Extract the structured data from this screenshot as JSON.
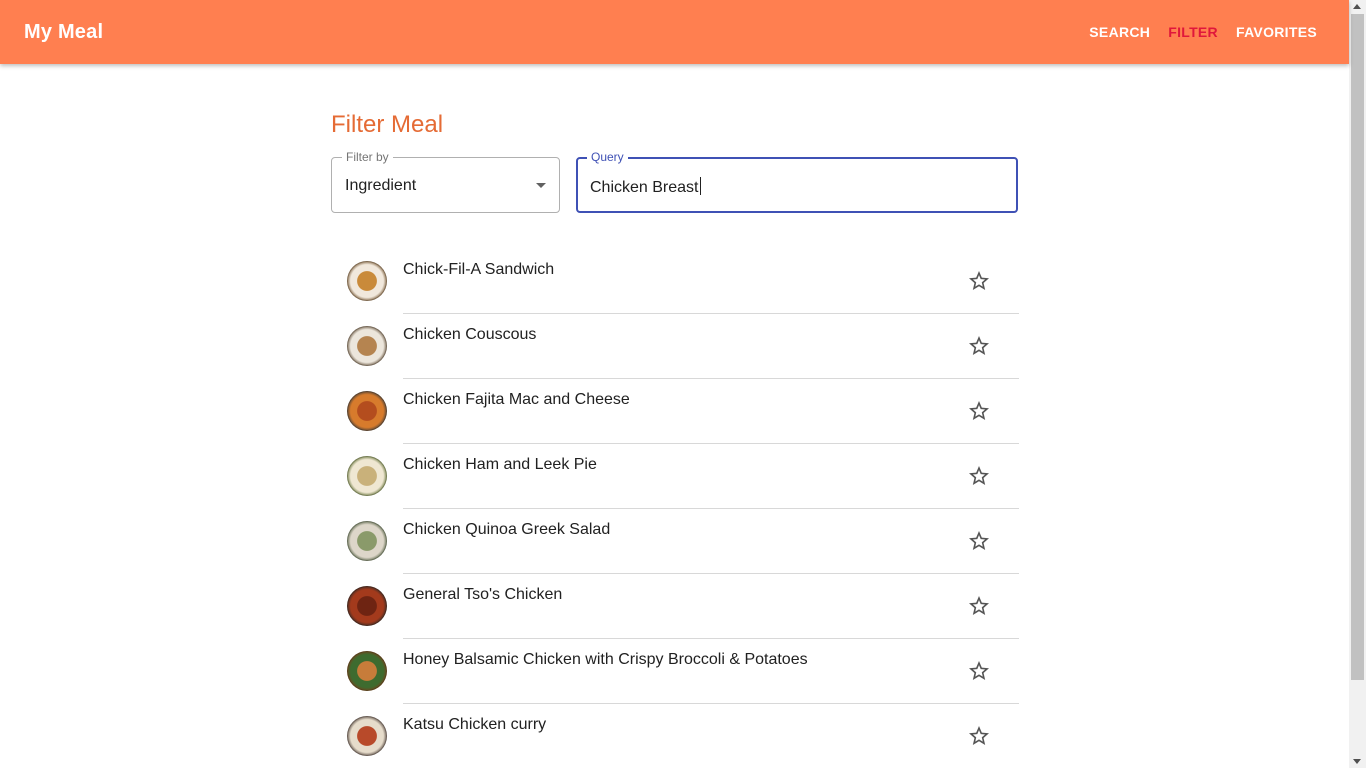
{
  "app": {
    "title": "My Meal"
  },
  "nav": [
    {
      "label": "SEARCH",
      "active": false
    },
    {
      "label": "FILTER",
      "active": true
    },
    {
      "label": "FAVORITES",
      "active": false
    }
  ],
  "page": {
    "title": "Filter Meal"
  },
  "filter": {
    "label": "Filter by",
    "value": "Ingredient"
  },
  "query": {
    "label": "Query",
    "value": "Chicken Breast"
  },
  "colors": {
    "appbar": "#ff7f50",
    "active_nav": "#e0173b",
    "title": "#e56b35",
    "focus": "#3f51b5"
  },
  "meals": [
    {
      "name": "Chick-Fil-A Sandwich",
      "thumb_colors": [
        "#f1e8dc",
        "#c98a3a",
        "#6b4a24"
      ],
      "icon": "star-outline-icon"
    },
    {
      "name": "Chicken Couscous",
      "thumb_colors": [
        "#ece6dc",
        "#b58450",
        "#5e4a33"
      ],
      "icon": "star-outline-icon"
    },
    {
      "name": "Chicken Fajita Mac and Cheese",
      "thumb_colors": [
        "#d77b2c",
        "#b44d1e",
        "#3a3a3a"
      ],
      "icon": "star-outline-icon"
    },
    {
      "name": "Chicken Ham and Leek Pie",
      "thumb_colors": [
        "#efe7d2",
        "#c9b17a",
        "#5b6b2e"
      ],
      "icon": "star-outline-icon"
    },
    {
      "name": "Chicken Quinoa Greek Salad",
      "thumb_colors": [
        "#ddd6c9",
        "#8a9a6a",
        "#4c5a3c"
      ],
      "icon": "star-outline-icon"
    },
    {
      "name": "General Tso's Chicken",
      "thumb_colors": [
        "#a33a1c",
        "#6e2412",
        "#2f2a26"
      ],
      "icon": "star-outline-icon"
    },
    {
      "name": "Honey Balsamic Chicken with Crispy Broccoli & Potatoes",
      "thumb_colors": [
        "#3e6b2f",
        "#c77c3a",
        "#7a3d1a"
      ],
      "icon": "star-outline-icon"
    },
    {
      "name": "Katsu Chicken curry",
      "thumb_colors": [
        "#e6dccb",
        "#b84a2a",
        "#4a3b34"
      ],
      "icon": "star-outline-icon"
    }
  ]
}
